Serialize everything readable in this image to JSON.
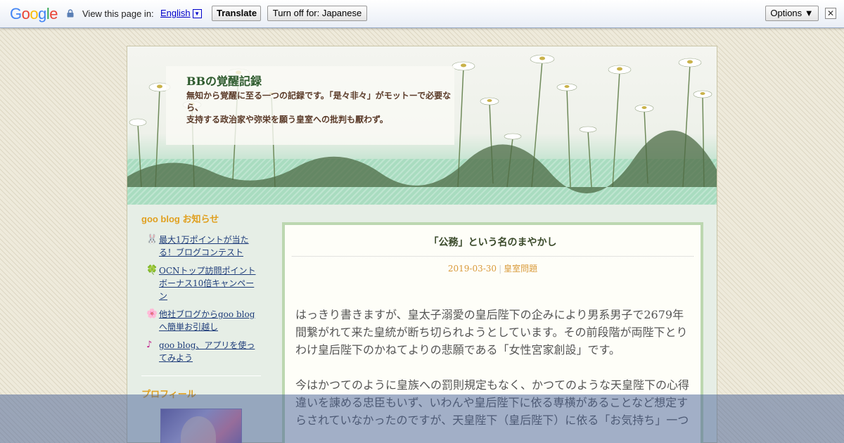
{
  "translate_bar": {
    "logo_letters": [
      "G",
      "o",
      "o",
      "g",
      "l",
      "e"
    ],
    "view_label": "View this page in:",
    "language": "English",
    "language_arrow": "▼",
    "translate_label": "Translate",
    "turn_off_label": "Turn off for: Japanese",
    "options_label": "Options ▼",
    "close_label": "✕"
  },
  "header": {
    "title": "BBの覚醒記録",
    "description_line1": "無知から覚醒に至る一つの記録です。「是々非々」がモットーで必要なら、",
    "description_line2": "支持する政治家や弥栄を願う皇室への批判も厭わず。"
  },
  "sidebar": {
    "notice_heading": "goo blog お知らせ",
    "notices": [
      {
        "icon": "🐰",
        "label": "最大1万ポイントが当たる！ブログコンテスト"
      },
      {
        "icon": "🍀",
        "label": "OCNトップ訪問ポイント ボーナス10倍キャンペーン"
      },
      {
        "icon": "🌸",
        "label": "他社ブログからgoo blogへ簡単お引越し"
      },
      {
        "icon": "♪",
        "label": "goo blog、アプリを使ってみよう"
      }
    ],
    "profile_heading": "プロフィール"
  },
  "entry": {
    "title": "「公務」という名のまやかし",
    "date": "2019-03-30",
    "separator": "|",
    "category": "皇室問題",
    "paragraph1": "はっきり書きますが、皇太子溺愛の皇后陛下の企みにより男系男子で2679年間繋がれて来た皇統が断ち切られようとしています。その前段階が両陛下とりわけ皇后陛下のかねてよりの悲願である「女性宮家創設」です。",
    "paragraph2": "今はかつてのように皇族への罰則規定もなく、かつてのような天皇陛下の心得違いを諌める忠臣もいず、いわんや皇后陛下に依る専横があることなど想定すらされていなかったのですが、天皇陛下（皇后陛下）に依る「お気持ち」一つ"
  },
  "colors": {
    "title_green": "#2d5a2d",
    "meta_orange": "#d99a3a",
    "heading_orange": "#e0a020",
    "entry_border": "#bcd7b0",
    "header_green": "#a9dcc0"
  }
}
